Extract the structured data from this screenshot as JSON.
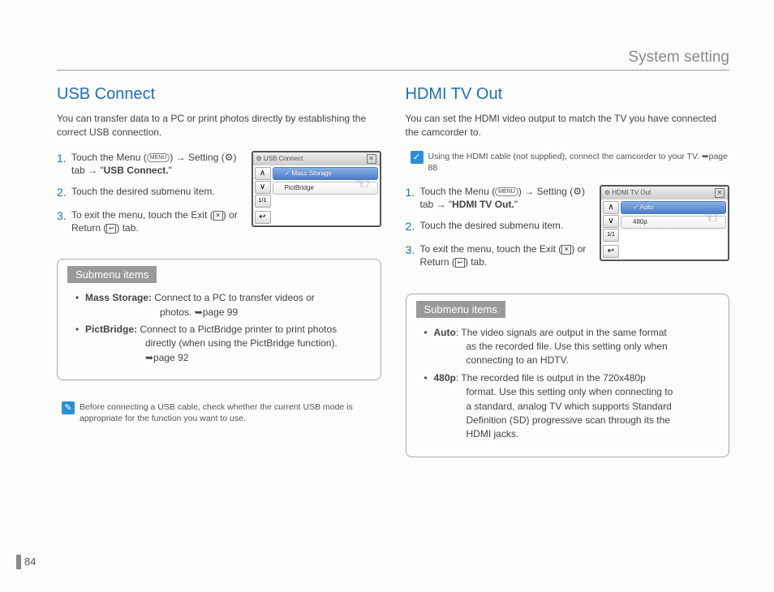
{
  "header": {
    "title": "System setting"
  },
  "page_number": "84",
  "left": {
    "title": "USB Connect",
    "intro": "You can transfer data to a PC or print photos directly by establishing the correct USB connection.",
    "steps": {
      "s1a": "Touch the Menu (",
      "s1_menu": "MENU",
      "s1b": ") → Setting (",
      "s1_gear": "⚙",
      "s1c": ") tab → \"",
      "s1_bold": "USB Connect.",
      "s1d": "\"",
      "s2": "Touch the desired submenu item.",
      "s3a": "To exit the menu, touch the Exit (",
      "s3_x": "✕",
      "s3b": ") or Return (",
      "s3_ret": "↩",
      "s3c": ") tab."
    },
    "screen": {
      "title": "USB Connect",
      "close": "✕",
      "item1": "Mass Storage",
      "item2": "PictBridge",
      "pointer": "☜"
    },
    "submenu": {
      "header": "Submenu items",
      "i1_label": "Mass Storage:",
      "i1_text": " Connect to a PC to transfer videos or",
      "i1_cont": "photos. ➥page 99",
      "i2_label": "PictBridge:",
      "i2_text": " Connect to a PictBridge printer to print photos",
      "i2_cont1": "directly (when using the PictBridge function).",
      "i2_cont2": "➥page 92"
    },
    "note": "Before connecting a USB cable, check whether the current USB mode is appropriate for the function you want to use."
  },
  "right": {
    "title": "HDMI TV Out",
    "intro": "You can set the HDMI video output to match the TV you have connected the camcorder to.",
    "banner": "Using the HDMI cable (not supplied), connect the camcorder to your TV. ➥page 88",
    "steps": {
      "s1a": "Touch the Menu (",
      "s1_menu": "MENU",
      "s1b": ") → Setting (",
      "s1_gear": "⚙",
      "s1c": ") tab → \"",
      "s1_bold": "HDMI TV Out.",
      "s1d": "\"",
      "s2": "Touch the desired submenu item.",
      "s3a": "To exit the menu, touch the Exit (",
      "s3_x": "✕",
      "s3b": ") or Return (",
      "s3_ret": "↩",
      "s3c": ") tab."
    },
    "screen": {
      "title": "HDMI TV Out",
      "close": "✕",
      "item1": "Auto",
      "item2": "480p",
      "pointer": "☜"
    },
    "submenu": {
      "header": "Submenu items",
      "i1_label": "Auto",
      "i1_text": ": The video signals are output in the same format",
      "i1_cont1": "as the recorded file. Use this setting only when",
      "i1_cont2": "connecting to an HDTV.",
      "i2_label": "480p",
      "i2_text": ": The recorded file is output in the 720x480p",
      "i2_cont1": "format. Use this setting only when connecting to",
      "i2_cont2": "a standard, analog TV which supports Standard",
      "i2_cont3": "Definition (SD) progressive scan through its the",
      "i2_cont4": "HDMI jacks."
    }
  }
}
